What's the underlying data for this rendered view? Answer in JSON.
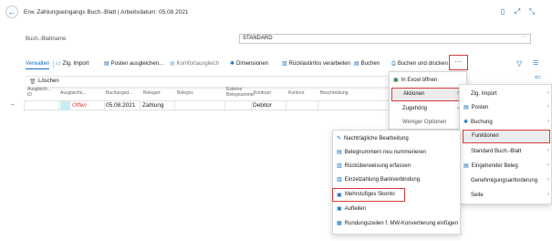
{
  "header": {
    "title": "Erw. Zahlungseingangs Buch.-Blatt | Arbeitsdatum: 05.08.2021",
    "icons": [
      "bookmark-icon",
      "open-new-window-icon",
      "collapse-icon"
    ]
  },
  "batch": {
    "label": "Buch.-Blattname",
    "value": "STANDARD",
    "lookup": "···"
  },
  "actionbar": {
    "items": [
      {
        "label": "Verwalten",
        "icon": ""
      },
      {
        "label": "Zlg. Import",
        "icon": "📄"
      },
      {
        "label": "Posten ausgleichen...",
        "icon": "▤"
      },
      {
        "label": "Komfortausgleich",
        "icon": "▦"
      },
      {
        "label": "Dimensionen",
        "icon": "✱"
      },
      {
        "label": "Rücklastinfos verarbeiten",
        "icon": "▥"
      },
      {
        "label": "Buchen",
        "icon": "▤"
      },
      {
        "label": "Buchen und drucken",
        "icon": "🖶"
      }
    ],
    "more": "···",
    "filter_icon": "▽",
    "list_icon": "☰"
  },
  "manage_menu": {
    "delete": "Löschen",
    "delete_icon": "🗑"
  },
  "grid": {
    "headers": [
      "Ausgleich... ID",
      "Ausgleichs...",
      "Buchungsd...",
      "Belegart",
      "Belegnr.",
      "Externe Belegnummer",
      "Kontoart",
      "Kontonr.",
      "Beschreibung"
    ],
    "row": {
      "arrow": "→",
      "status": "Offen",
      "date": "05.08.2021",
      "doc_type": "Zahlung",
      "account_type": "Debitor"
    }
  },
  "more_menu": {
    "items": [
      "In Excel öffnen",
      "Aktionen",
      "Zugehörig",
      "Weniger Optionen"
    ],
    "pin_icon": "⇦"
  },
  "actions_menu": {
    "items": [
      "Zlg. Import",
      "Posten",
      "Buchung",
      "Funktionen",
      "Standard Buch.-Blatt",
      "Eingehender Beleg",
      "Genehmigungsanforderung",
      "Seite"
    ]
  },
  "functions_menu": {
    "items": [
      "Nachträgliche Bearbeitung",
      "Belegnummern neu nummerieren",
      "Rücküberweisung erfassen",
      "Einzelzahlung Bankverbindung",
      "Mehrstufiges Skonto",
      "Aufteilen",
      "Rundungszeilen f. MW-Konvertierung einfügen"
    ]
  },
  "colors": {
    "accent": "#0f6cbd",
    "highlight_border": "#d83b3b",
    "status_red": "#d83b3b",
    "cell_highlight": "#c8ecf4"
  }
}
